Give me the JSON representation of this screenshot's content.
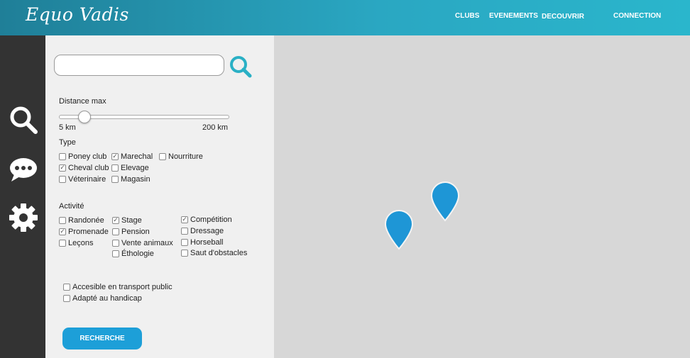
{
  "header": {
    "logo": "Equo Vadis",
    "nav": {
      "clubs": "CLUBS",
      "events": "EVENEMENTS",
      "discover": "DECOUVRIR",
      "connect": "CONNECTION"
    }
  },
  "sidebar": {
    "icons": [
      "search-icon",
      "chat-bubble-icon",
      "gear-icon"
    ]
  },
  "search": {
    "value": "",
    "placeholder": ""
  },
  "distance": {
    "label": "Distance max",
    "min_label": "5 km",
    "max_label": "200 km",
    "slider_fraction": 0.15
  },
  "type": {
    "label": "Type",
    "options": [
      {
        "label": "Poney club",
        "checked": false
      },
      {
        "label": "Marechal",
        "checked": true
      },
      {
        "label": "Nourriture",
        "checked": false
      },
      {
        "label": "Cheval club",
        "checked": true
      },
      {
        "label": "Elevage",
        "checked": false
      },
      {
        "label": "Véterinaire",
        "checked": false
      },
      {
        "label": "Magasin",
        "checked": false
      }
    ]
  },
  "activite": {
    "label": "Activité",
    "options": [
      {
        "label": "Randonée",
        "checked": false
      },
      {
        "label": "Stage",
        "checked": true
      },
      {
        "label": "Compétition",
        "checked": true
      },
      {
        "label": "Promenade",
        "checked": true
      },
      {
        "label": "Pension",
        "checked": false
      },
      {
        "label": "Dressage",
        "checked": false
      },
      {
        "label": "Leçons",
        "checked": false
      },
      {
        "label": "Vente animaux",
        "checked": false
      },
      {
        "label": "Horseball",
        "checked": false
      },
      {
        "label": "Éthologie",
        "checked": false
      },
      {
        "label": "Saut d'obstacles",
        "checked": false
      }
    ]
  },
  "extras": {
    "options": [
      {
        "label": "Accesible en transport public",
        "checked": false
      },
      {
        "label": "Adapté au handicap",
        "checked": false
      }
    ]
  },
  "button": {
    "label": "RECHERCHE"
  },
  "colors": {
    "header_start": "#1f7f98",
    "header_end": "#2ab6cc",
    "accent": "#1d9fd8",
    "search_icon": "#2ab0c5",
    "pin": "#1e96d6",
    "sidebar": "#333333"
  }
}
